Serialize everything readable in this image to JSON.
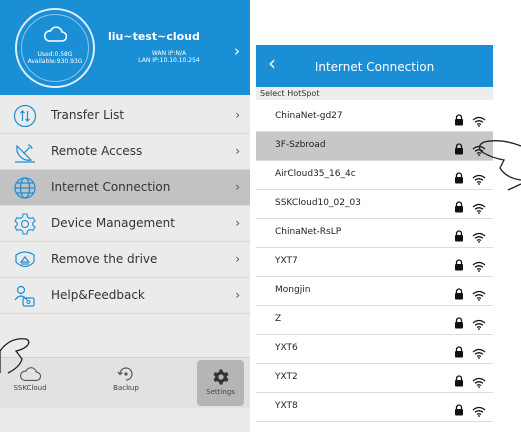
{
  "device": {
    "name": "liu~test~cloud",
    "used": "Used:0.58G",
    "available": "Available:930.93G",
    "wan_ip": "WAN IP:N/A",
    "lan_ip": "LAN IP:10.10.10.254"
  },
  "menu": [
    {
      "label": "Transfer List",
      "icon": "transfer-icon"
    },
    {
      "label": "Remote Access",
      "icon": "satellite-dish-icon"
    },
    {
      "label": "Internet Connection",
      "icon": "globe-icon"
    },
    {
      "label": "Device Management",
      "icon": "gear-icon"
    },
    {
      "label": "Remove the drive",
      "icon": "eject-shield-icon"
    },
    {
      "label": "Help&Feedback",
      "icon": "people-icon"
    }
  ],
  "tabs": [
    {
      "label": "SSKCloud",
      "icon": "cloud-icon"
    },
    {
      "label": "Backup",
      "icon": "backup-icon"
    },
    {
      "label": "Settings",
      "icon": "settings-gear-icon",
      "selected": true
    }
  ],
  "connection_screen": {
    "title": "Internet Connection",
    "section_label": "Select HotSpot",
    "hotspots": [
      {
        "name": "ChinaNet-gd27"
      },
      {
        "name": "3F-Szbroad",
        "selected": true
      },
      {
        "name": "AirCloud35_16_4c"
      },
      {
        "name": "SSKCloud10_02_03"
      },
      {
        "name": "ChinaNet-RsLP"
      },
      {
        "name": "YXT7"
      },
      {
        "name": "Mongjin"
      },
      {
        "name": "Z"
      },
      {
        "name": "YXT6"
      },
      {
        "name": "YXT2"
      },
      {
        "name": "YXT8"
      }
    ]
  },
  "colors": {
    "accent": "#1a8fd6",
    "selected_row": "#c2c2c2"
  }
}
